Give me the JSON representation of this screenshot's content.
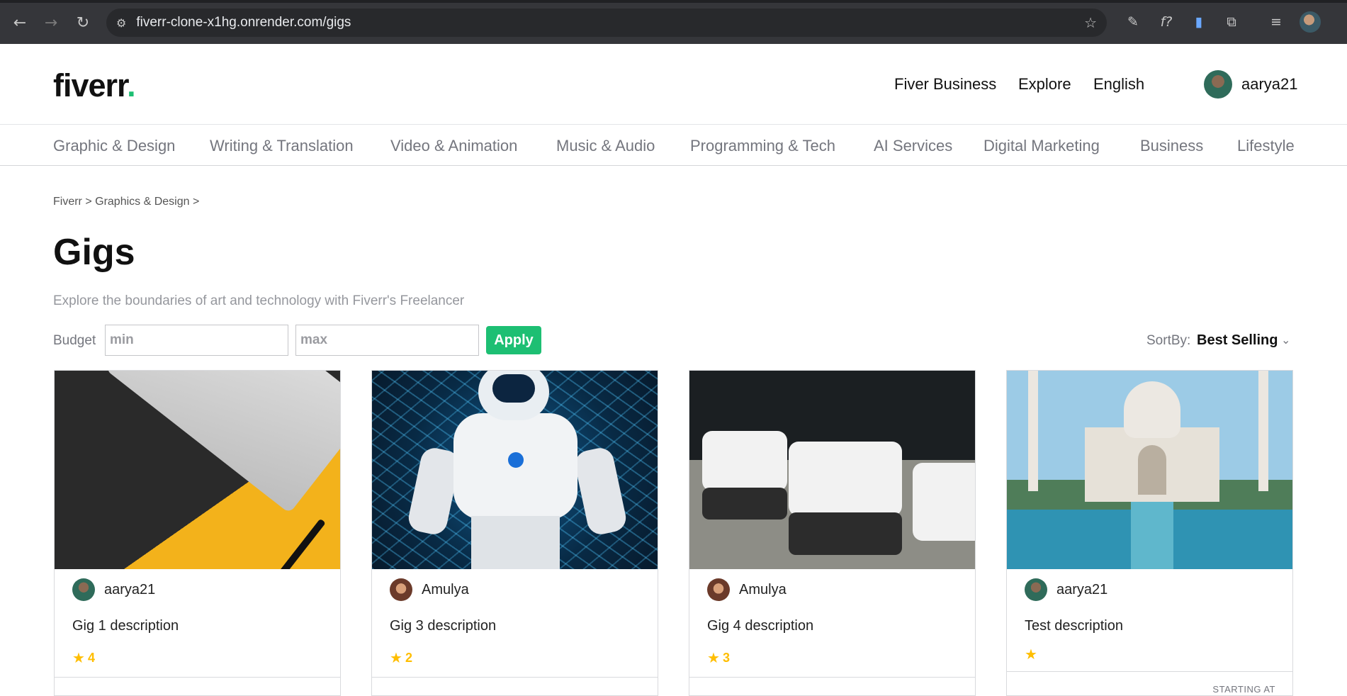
{
  "browser": {
    "url": "fiverr-clone-x1hg.onrender.com/gigs",
    "back_icon": "←",
    "forward_icon": "→",
    "reload_icon": "↻",
    "site_info_icon": "⚙",
    "star_icon": "☆",
    "ext_icons": [
      "✎",
      "f?",
      "▮",
      "⧉",
      "≡"
    ]
  },
  "header": {
    "logo_text": "fiverr",
    "logo_dot": ".",
    "nav": [
      "Fiver Business",
      "Explore",
      "English"
    ],
    "username": "aarya21"
  },
  "categories": [
    "Graphic & Design",
    "Writing & Translation",
    "Video & Animation",
    "Music & Audio",
    "Programming & Tech",
    "AI Services",
    "Digital Marketing",
    "Business",
    "Lifestyle"
  ],
  "breadcrumb": "Fiverr > Graphics & Design >",
  "page": {
    "title": "Gigs",
    "subtitle": "Explore the boundaries of art and technology with Fiverr's Freelancer"
  },
  "filters": {
    "budget_label": "Budget",
    "min_placeholder": "min",
    "max_placeholder": "max",
    "apply_label": "Apply",
    "sort_label": "SortBy:",
    "sort_value": "Best Selling",
    "sort_chevron": "⌄"
  },
  "gigs": [
    {
      "seller": "aarya21",
      "description": "Gig 1 description",
      "rating": "4",
      "star": "★"
    },
    {
      "seller": "Amulya",
      "description": "Gig 3 description",
      "rating": "2",
      "star": "★"
    },
    {
      "seller": "Amulya",
      "description": "Gig 4 description",
      "rating": "3",
      "star": "★"
    },
    {
      "seller": "aarya21",
      "description": "Test description",
      "rating": "",
      "star": "★",
      "starting_at": "STARTING AT"
    }
  ],
  "colors": {
    "accent": "#1dbf73",
    "star": "#ffbe00",
    "chrome": "#35363a"
  }
}
